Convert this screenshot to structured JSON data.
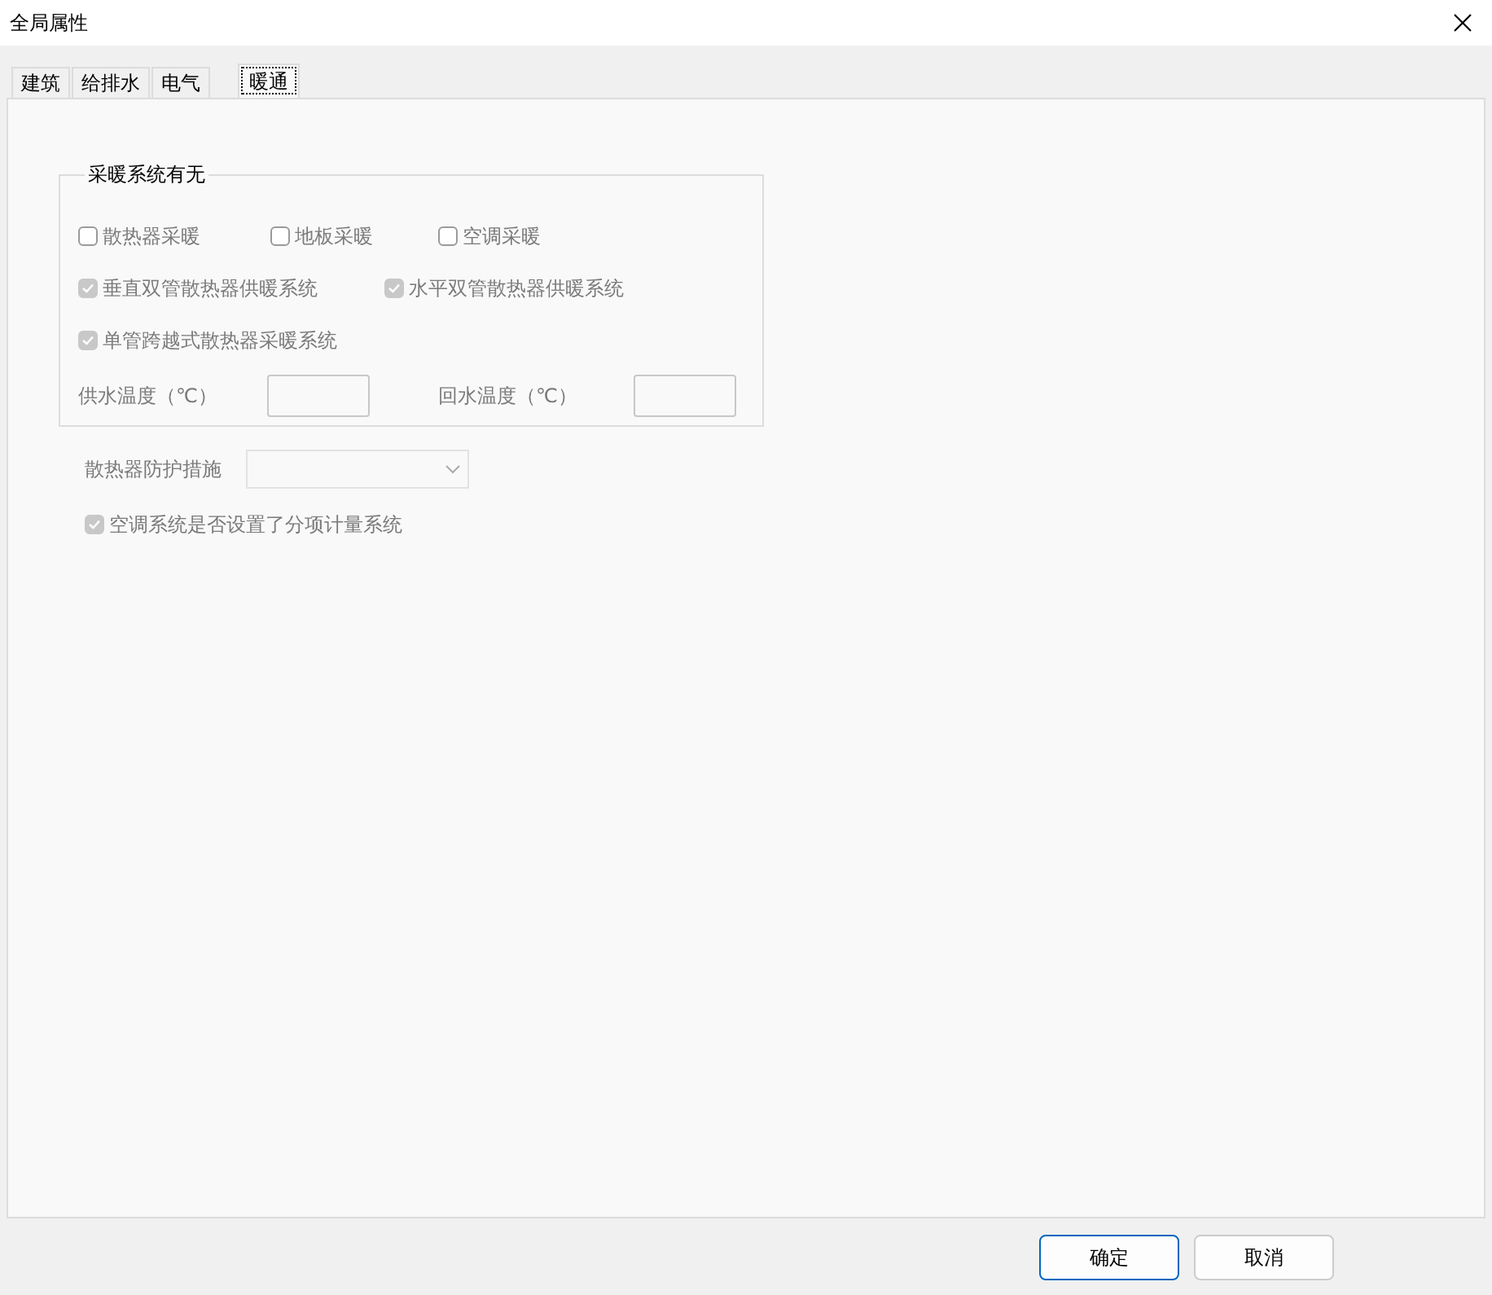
{
  "window": {
    "title": "全局属性"
  },
  "tabs": [
    {
      "label": "建筑",
      "selected": false
    },
    {
      "label": "给排水",
      "selected": false
    },
    {
      "label": "电气",
      "selected": false
    },
    {
      "label": "暖通",
      "selected": true
    }
  ],
  "heating_group": {
    "title": "采暖系统有无",
    "checkbox_rows": [
      [
        {
          "label": "散热器采暖",
          "checked": false,
          "disabled": true
        },
        {
          "label": "地板采暖",
          "checked": false,
          "disabled": true
        },
        {
          "label": "空调采暖",
          "checked": false,
          "disabled": true
        }
      ],
      [
        {
          "label": "垂直双管散热器供暖系统",
          "checked": true,
          "disabled": true
        },
        {
          "label": "水平双管散热器供暖系统",
          "checked": true,
          "disabled": true
        }
      ],
      [
        {
          "label": "单管跨越式散热器采暖系统",
          "checked": true,
          "disabled": true
        }
      ]
    ],
    "temperature_fields": [
      {
        "label": "供水温度（℃）",
        "disabled": true
      },
      {
        "label": "回水温度（℃）",
        "disabled": true
      }
    ]
  },
  "radiator_protection": {
    "label": "散热器防护措施",
    "disabled": true
  },
  "metering_checkbox": {
    "label": "空调系统是否设置了分项计量系统",
    "checked": true,
    "disabled": true
  },
  "buttons": [
    {
      "label": "确定",
      "kind": "primary"
    },
    {
      "label": "取消",
      "kind": "secondary"
    }
  ]
}
